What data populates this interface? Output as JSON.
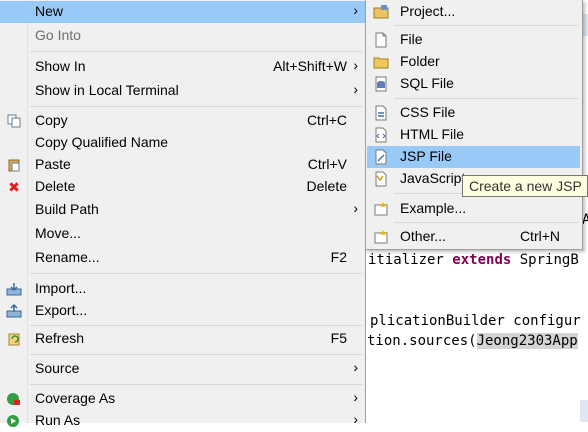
{
  "menu": {
    "items": [
      {
        "label": "New",
        "accel": "",
        "submenu": true
      },
      {
        "label": "Go Into",
        "accel": "",
        "submenu": false
      },
      {
        "label": "Show In",
        "accel": "Alt+Shift+W",
        "submenu": true
      },
      {
        "label": "Show in Local Terminal",
        "accel": "",
        "submenu": true
      },
      {
        "label": "Copy",
        "accel": "Ctrl+C",
        "submenu": false
      },
      {
        "label": "Copy Qualified Name",
        "accel": "",
        "submenu": false
      },
      {
        "label": "Paste",
        "accel": "Ctrl+V",
        "submenu": false
      },
      {
        "label": "Delete",
        "accel": "Delete",
        "submenu": false
      },
      {
        "label": "Build Path",
        "accel": "",
        "submenu": true
      },
      {
        "label": "Move...",
        "accel": "",
        "submenu": false
      },
      {
        "label": "Rename...",
        "accel": "F2",
        "submenu": false
      },
      {
        "label": "Import...",
        "accel": "",
        "submenu": false
      },
      {
        "label": "Export...",
        "accel": "",
        "submenu": false
      },
      {
        "label": "Refresh",
        "accel": "F5",
        "submenu": false
      },
      {
        "label": "Source",
        "accel": "",
        "submenu": true
      },
      {
        "label": "Coverage As",
        "accel": "",
        "submenu": true
      },
      {
        "label": "Run As",
        "accel": "",
        "submenu": true
      }
    ],
    "arrow": "›"
  },
  "submenu": {
    "items": [
      {
        "label": "Project...",
        "accel": ""
      },
      {
        "label": "File",
        "accel": ""
      },
      {
        "label": "Folder",
        "accel": ""
      },
      {
        "label": "SQL File",
        "accel": ""
      },
      {
        "label": "CSS File",
        "accel": ""
      },
      {
        "label": "HTML File",
        "accel": ""
      },
      {
        "label": "JSP File",
        "accel": ""
      },
      {
        "label": "JavaScript",
        "accel": ""
      },
      {
        "label": "Example...",
        "accel": ""
      },
      {
        "label": "Other...",
        "accel": "Ctrl+N"
      }
    ]
  },
  "tooltip": {
    "text": "Create a new JSP"
  },
  "editor": {
    "line1_pre": "itializer ",
    "line1_kw": "extends",
    "line1_post": " SpringB",
    "line2": "plicationBuilder configur",
    "line3_pre": "tion.sources(",
    "line3_hl": "Jeong2303App",
    "edge_letter": "A"
  },
  "colors": {
    "hover": "#99c9f6",
    "menu_bg": "#f0f0f0",
    "keyword": "#7f0055"
  }
}
